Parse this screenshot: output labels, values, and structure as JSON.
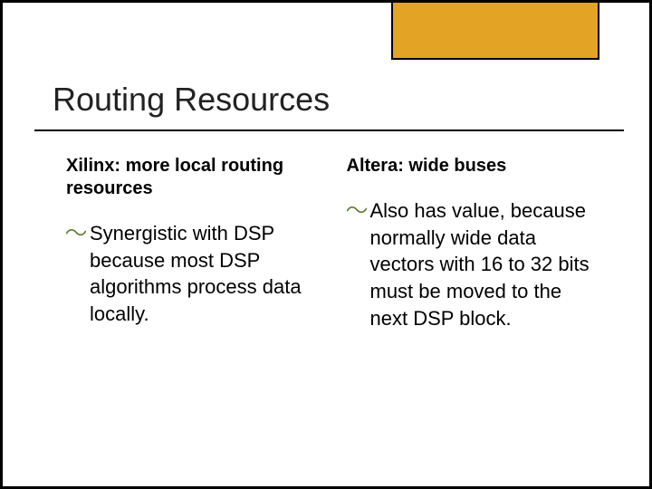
{
  "title": "Routing Resources",
  "columns": {
    "left": {
      "heading": "Xilinx: more local routing resources",
      "bullet": "Synergistic with DSP because most DSP algorithms process data locally."
    },
    "right": {
      "heading": "Altera: wide buses",
      "bullet": "Also has value, because normally wide data vectors with 16 to 32 bits must be moved to the next DSP block."
    }
  }
}
